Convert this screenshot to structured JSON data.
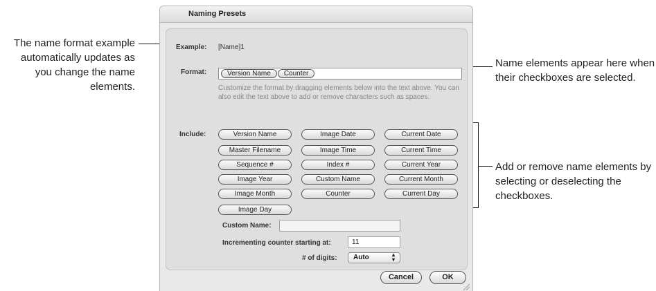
{
  "callouts": {
    "format_example": "The name format example automatically updates as you change the name elements.",
    "elements_appear": "Name elements appear here when their checkboxes are selected.",
    "add_remove": "Add or remove name elements by selecting or deselecting the checkboxes."
  },
  "window": {
    "title": "Naming Presets",
    "example_label": "Example:",
    "example_value": "[Name]1",
    "format_label": "Format:",
    "format_tokens": [
      "Version Name",
      "Counter"
    ],
    "format_hint": "Customize the format by dragging elements below into the text above. You can also edit the text above to add or remove characters such as spaces.",
    "include_label": "Include:",
    "include_items": [
      "Version Name",
      "Image Date",
      "Current Date",
      "Master Filename",
      "Image Time",
      "Current Time",
      "Sequence #",
      "Index #",
      "Current Year",
      "Image Year",
      "Custom Name",
      "Current Month",
      "Image Month",
      "Counter",
      "Current Day",
      "Image Day"
    ],
    "custom_name_label": "Custom Name:",
    "custom_name_value": "",
    "counter_label": "Incrementing counter starting at:",
    "counter_value": "11",
    "digits_label": "# of digits:",
    "digits_value": "Auto",
    "cancel_label": "Cancel",
    "ok_label": "OK"
  },
  "colors": {
    "window_bg": "#e9e9e9",
    "panel_bg": "#dfdfdf",
    "hint_text": "#888888"
  }
}
